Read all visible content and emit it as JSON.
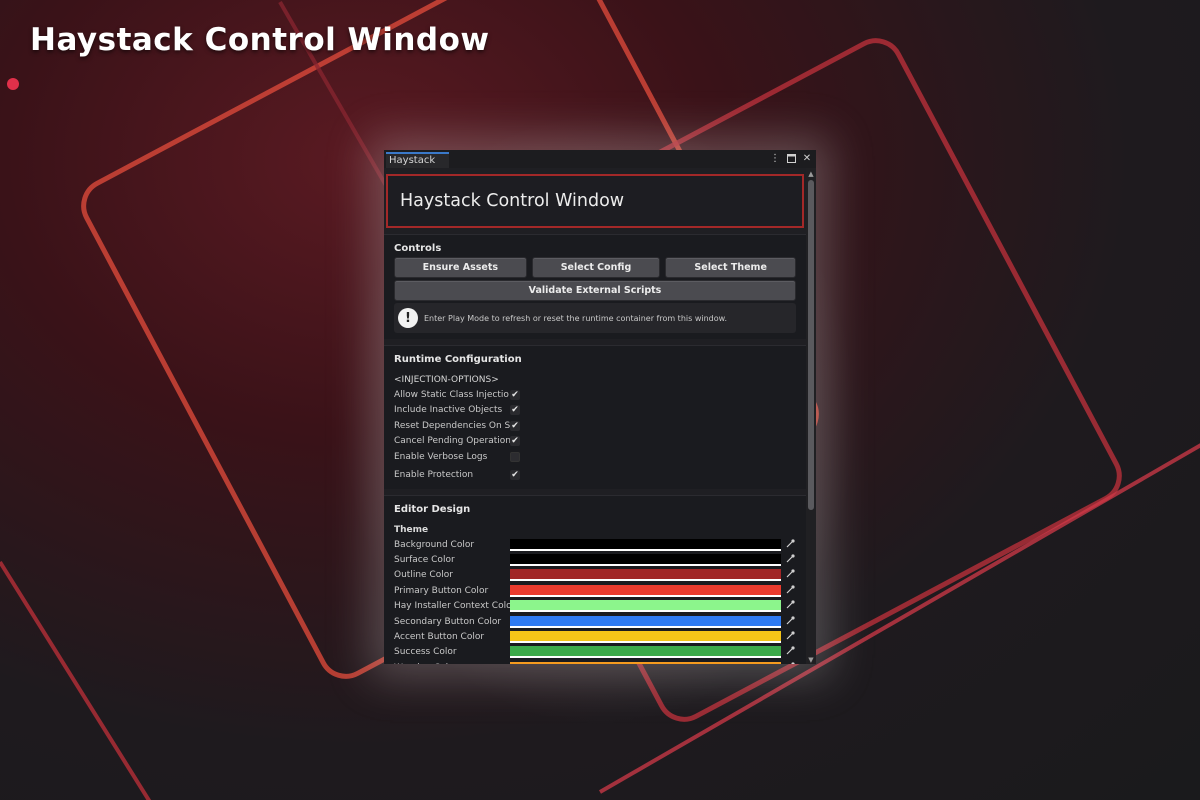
{
  "hero": {
    "title": "Haystack Control Window"
  },
  "window": {
    "tab": "Haystack",
    "controls": {
      "menu_icon": "kebab-menu-icon",
      "maximize_icon": "maximize-icon",
      "close_icon": "close-icon"
    },
    "header_title": "Haystack Control Window"
  },
  "controls_section": {
    "title": "Controls",
    "buttons": [
      "Ensure Assets",
      "Select Config",
      "Select Theme"
    ],
    "validate_button": "Validate External Scripts",
    "info": {
      "icon": "!",
      "text": "Enter Play Mode to refresh or reset the runtime container from this window."
    }
  },
  "runtime_section": {
    "title": "Runtime Configuration",
    "group_label": "<INJECTION-OPTIONS>",
    "options": [
      {
        "label": "Allow Static Class Injectio",
        "checked": true
      },
      {
        "label": "Include Inactive Objects",
        "checked": true
      },
      {
        "label": "Reset Dependencies On S",
        "checked": true
      },
      {
        "label": "Cancel Pending Operation",
        "checked": true
      },
      {
        "label": "Enable Verbose Logs",
        "checked": false
      },
      {
        "label": "Enable Protection",
        "checked": true
      }
    ]
  },
  "editor_design": {
    "title": "Editor Design",
    "theme_label": "Theme",
    "colors": [
      {
        "label": "Background Color",
        "color": "#000000"
      },
      {
        "label": "Surface Color",
        "color": "#000000"
      },
      {
        "label": "Outline Color",
        "color": "#a12525"
      },
      {
        "label": "Primary Button Color",
        "color": "#ea3b2e"
      },
      {
        "label": "Hay Installer Context Colo",
        "color": "#8cf58c"
      },
      {
        "label": "Secondary Button Color",
        "color": "#2f7bf2"
      },
      {
        "label": "Accent Button Color",
        "color": "#f5c518"
      },
      {
        "label": "Success Color",
        "color": "#3daa4a"
      },
      {
        "label": "Warning Color",
        "color": "#f59b1f"
      }
    ]
  }
}
